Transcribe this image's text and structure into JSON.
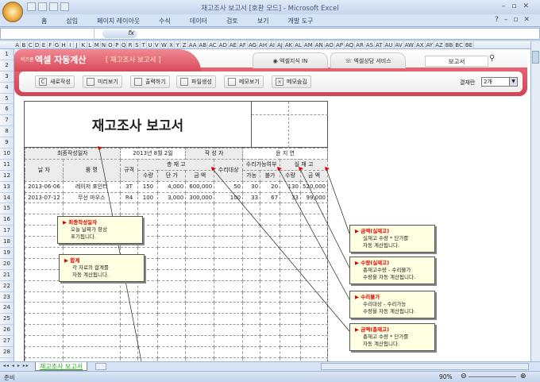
{
  "window": {
    "title": "재고조사 보고서 [호환 모드] - Microsoft Excel"
  },
  "ribbon_tabs": [
    "홈",
    "삽입",
    "페이지 레이아웃",
    "수식",
    "데이터",
    "검토",
    "보기",
    "개발 도구"
  ],
  "formula_bar": {
    "fx": "fx",
    "value": ""
  },
  "column_headers": [
    "A",
    "B",
    "C",
    "D",
    "E",
    "F",
    "G",
    "H",
    "I",
    "J",
    "K",
    "L",
    "M",
    "N",
    "O",
    "P",
    "Q",
    "R",
    "S",
    "T",
    "U",
    "V",
    "W",
    "X",
    "Y",
    "Z",
    "AA",
    "AB",
    "AC",
    "AD",
    "AE",
    "AF",
    "AG",
    "AH",
    "AI",
    "AJ",
    "AK",
    "AL",
    "AM",
    "AN",
    "AO",
    "AP",
    "AQ",
    "AR",
    "AS",
    "AT",
    "AU",
    "AV",
    "AW",
    "AX",
    "AY",
    "AZ",
    "BB",
    "BC",
    "BE"
  ],
  "row_headers": [
    "1",
    "2",
    "3",
    "4",
    "5",
    "6",
    "7",
    "8",
    "9",
    "10",
    "11",
    "12",
    "13",
    "14",
    "15",
    "16",
    "17",
    "18",
    "19",
    "20",
    "21",
    "22",
    "23",
    "24",
    "25",
    "26",
    "27",
    "28"
  ],
  "banner": {
    "brand_small": "비즈폼",
    "brand": "엑셀 자동계산",
    "subtitle": "[ 재고조사 보고서 ]",
    "tab1": "엑셀지식 IN",
    "tab2": "엑셀상담 서비스",
    "search_value": "보고서",
    "buttons": [
      "새로작성",
      "미리보기",
      "출력하기",
      "파일생성",
      "메모보기",
      "메모숨김"
    ],
    "approval_label": "결재란",
    "approval_value": "2개"
  },
  "report": {
    "title": "재고조사 보고서",
    "last_date_label": "최종작성일자",
    "last_date": "2013년 8월 2일",
    "author_label": "작 성 자",
    "author": "윤 지 연",
    "headers": {
      "date": "날 자",
      "item": "품 명",
      "spec": "규격",
      "total_stock": "총 재 고",
      "qty": "수량",
      "price": "단 가",
      "amount": "금 액",
      "repair_target": "수리대상",
      "repairable": "수리가능여부",
      "possible": "가능",
      "impossible": "불가",
      "actual_stock": "실 재 고",
      "actual_qty": "수량",
      "actual_amount": "금 액"
    },
    "rows": [
      {
        "date": "2013-06-06",
        "item": "레이저 포인터",
        "spec": "3T",
        "qty": "150",
        "price": "4,000",
        "amount": "600,000",
        "repair": "50",
        "possible": "30",
        "impossible": "20",
        "actual_qty": "130",
        "actual_amount": "520,000"
      },
      {
        "date": "2013-07-12",
        "item": "무선 마우스",
        "spec": "R4",
        "qty": "100",
        "price": "3,000",
        "amount": "300,000",
        "repair": "100",
        "possible": "33",
        "impossible": "67",
        "actual_qty": "33",
        "actual_amount": "99,000"
      }
    ]
  },
  "callouts": [
    {
      "title": "최종작성일자",
      "body": [
        "오늘 날짜가 항상",
        "표기됩니다."
      ]
    },
    {
      "title": "합계",
      "body": [
        "각 자료의 합계를",
        "자동 계산됩니다."
      ]
    },
    {
      "title": "금액(실재고)",
      "body": [
        "실재고 수량 * 단가를",
        "자동 계산됩니다."
      ]
    },
    {
      "title": "수량(실재고)",
      "body": [
        "총재고수량 - 수리불가",
        "수량을 자동 계산됩니다."
      ]
    },
    {
      "title": "수리불가",
      "body": [
        "수리대상 - 수리가능",
        "수량을 자동 계산됩니다."
      ]
    },
    {
      "title": "금액(총재고)",
      "body": [
        "총재고 수량 * 단가를",
        "자동 계산됩니다."
      ]
    }
  ],
  "sheet_tab": "재고조사 보고서",
  "status": {
    "text": "준비",
    "zoom": "90%"
  }
}
